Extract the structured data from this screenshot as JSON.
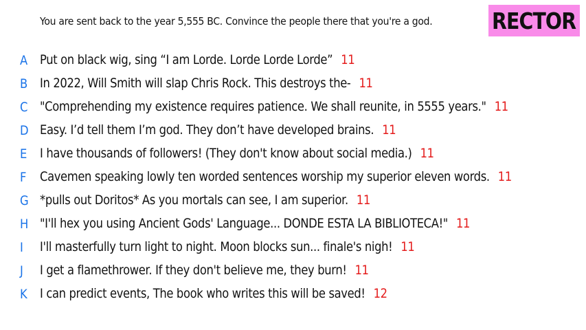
{
  "prompt": "You are sent back to the year 5,555 BC. Convince the people there that you're a god.",
  "badge": "RECTOR",
  "colors": {
    "letter": "#1a73e8",
    "score": "#e41b1b",
    "badge_bg": "#f98be9"
  },
  "answers": [
    {
      "letter": "A",
      "text": "Put on black wig, sing “I am Lorde. Lorde Lorde Lorde”",
      "score": "11"
    },
    {
      "letter": "B",
      "text": "In 2022, Will Smith will slap Chris Rock. This destroys the-",
      "score": "11"
    },
    {
      "letter": "C",
      "text": "\"Comprehending my existence requires patience. We shall reunite, in 5555 years.\"",
      "score": "11"
    },
    {
      "letter": "D",
      "text": "Easy. I’d tell them I’m god. They don’t have developed brains.",
      "score": "11"
    },
    {
      "letter": "E",
      "text": "I have thousands of followers! (They don't know about social media.)",
      "score": "11"
    },
    {
      "letter": "F",
      "text": "Cavemen speaking lowly ten worded sentences worship my superior eleven words.",
      "score": "11"
    },
    {
      "letter": "G",
      "text": "*pulls out Doritos* As you mortals can see, I am superior.",
      "score": "11"
    },
    {
      "letter": "H",
      "text": "\"I'll hex you using Ancient Gods' Language... DONDE ESTA LA BIBLIOTECA!\"",
      "score": "11"
    },
    {
      "letter": "I",
      "text": "I'll masterfully turn light to night. Moon blocks sun... finale's nigh!",
      "score": "11"
    },
    {
      "letter": "J",
      "text": "I get a flamethrower. If they don't believe me, they burn!",
      "score": "11"
    },
    {
      "letter": "K",
      "text": "I can predict events, The book who writes this will be saved!",
      "score": "12"
    }
  ]
}
